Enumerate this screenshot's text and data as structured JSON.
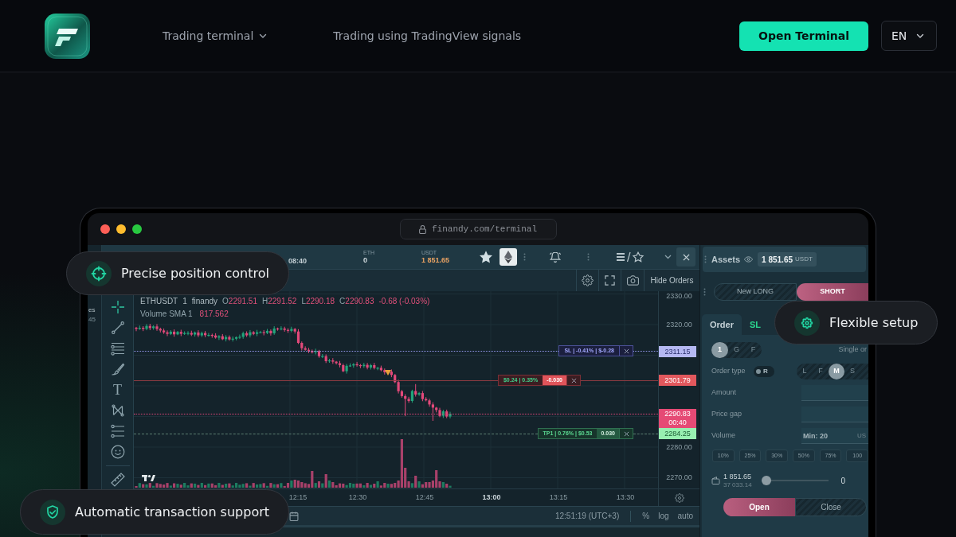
{
  "header": {
    "nav": [
      {
        "label": "Trading terminal",
        "dropdown": true
      },
      {
        "label": "Trading using TradingView signals",
        "dropdown": false
      }
    ],
    "cta": "Open Terminal",
    "language": "EN"
  },
  "browser": {
    "url": "finandy.com/terminal"
  },
  "terminal": {
    "left_panel_fragments": [
      "es",
      "45"
    ],
    "top_bar": {
      "clock": "08:40",
      "balances": [
        {
          "label": "ETH",
          "value": "0",
          "kind": "plain"
        },
        {
          "label": "USDT",
          "value": "1 851.65",
          "kind": "highlight"
        }
      ]
    },
    "chart_toolbar": {
      "hide_orders": "Hide Orders"
    },
    "drawing_toolbar": {
      "text_tool": "T"
    },
    "legend": {
      "symbol": "ETHUSDT",
      "interval": "1",
      "source": "finandy",
      "ohlc": [
        {
          "key": "O",
          "value": "2291.51"
        },
        {
          "key": "H",
          "value": "2291.52"
        },
        {
          "key": "L",
          "value": "2290.18"
        },
        {
          "key": "C",
          "value": "2290.83"
        }
      ],
      "change": "-0.68 (-0.03%)",
      "indicator": "Volume SMA 1",
      "indicator_value": "817.562"
    },
    "price_axis": [
      "2330.00",
      "2320.00",
      "2280.00",
      "2270.00"
    ],
    "price_tags": [
      {
        "kind": "sl",
        "value": "2311.15"
      },
      {
        "kind": "position",
        "value": "2301.79"
      },
      {
        "kind": "last",
        "value": "2290.83",
        "countdown": "00:40"
      },
      {
        "kind": "tp",
        "value": "2284.25"
      }
    ],
    "orders": [
      {
        "kind": "sl",
        "text": "SL | -0.41% | $-0.28"
      },
      {
        "kind": "position",
        "text": "$0.24 | 0.35%",
        "qty": "-0.030"
      },
      {
        "kind": "tp",
        "text": "TP1 | 0.76% | $0.53",
        "qty": "0.030"
      }
    ],
    "time_axis": [
      {
        "label": "12:15",
        "bold": false
      },
      {
        "label": "12:30",
        "bold": false
      },
      {
        "label": "12:45",
        "bold": false
      },
      {
        "label": "13:00",
        "bold": true
      },
      {
        "label": "13:15",
        "bold": false
      },
      {
        "label": "13:30",
        "bold": false
      }
    ],
    "status_bar": {
      "time": "12:51:19 (UTC+3)",
      "options": [
        "%",
        "log",
        "auto"
      ]
    }
  },
  "order_panel": {
    "assets": {
      "label": "Assets",
      "balance": "1 851.65",
      "currency": "USDT"
    },
    "direction": [
      {
        "label": "New LONG",
        "selected": false
      },
      {
        "label": "SHORT",
        "selected": true
      }
    ],
    "tabs": [
      {
        "label": "Order",
        "selected": true
      },
      {
        "label": "SL",
        "selected": false
      }
    ],
    "split_modes": [
      {
        "label": "1",
        "selected": true
      },
      {
        "label": "G",
        "selected": false
      },
      {
        "label": "F",
        "selected": false
      }
    ],
    "split_note": "Single or",
    "order_type": {
      "label": "Order type",
      "switch": "R",
      "on": false
    },
    "order_modes": [
      {
        "label": "L",
        "selected": false
      },
      {
        "label": "F",
        "selected": false
      },
      {
        "label": "M",
        "selected": true
      },
      {
        "label": "S",
        "selected": false
      }
    ],
    "fields": [
      {
        "label": "Amount"
      },
      {
        "label": "Price gap"
      },
      {
        "label": "Volume",
        "placeholder": "Min: 20",
        "unit": "US"
      }
    ],
    "percents": [
      "10%",
      "25%",
      "30%",
      "50%",
      "75%",
      "100"
    ],
    "balance": {
      "value": "1 851.65",
      "secondary": "37 033.14",
      "level": 0,
      "reading": "0"
    },
    "actions": [
      {
        "label": "Open",
        "selected": true
      },
      {
        "label": "Close",
        "selected": false
      }
    ]
  },
  "features": [
    "Precise position control",
    "Flexible setup",
    "Automatic transaction support"
  ]
}
